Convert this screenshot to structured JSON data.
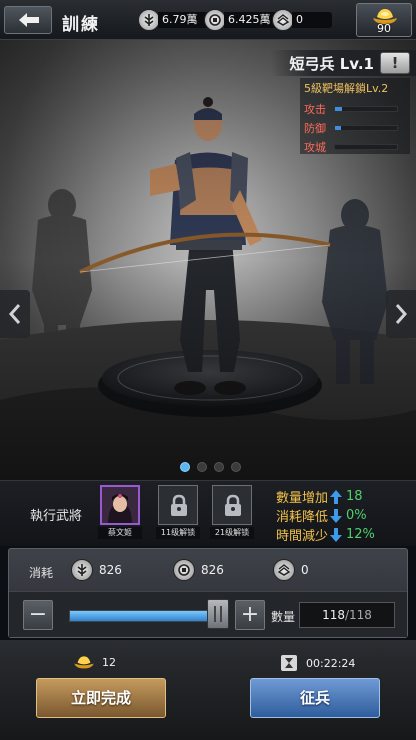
{
  "header": {
    "title": "訓練",
    "resources": [
      {
        "icon": "grain-icon",
        "value": "6.79萬"
      },
      {
        "icon": "coin-icon",
        "value": "6.425萬"
      },
      {
        "icon": "wood-icon",
        "value": "0"
      }
    ],
    "gold": {
      "icon": "gold-ingot-icon",
      "value": "90"
    }
  },
  "unit": {
    "name": "短弓兵 Lv.1",
    "unlock_text": "5級靶場解鎖Lv.2",
    "stats": [
      {
        "label": "攻击",
        "level": 0.12
      },
      {
        "label": "防御",
        "level": 0.1
      },
      {
        "label": "攻城",
        "level": 0.0
      }
    ],
    "page_count": 4,
    "active_page": 0
  },
  "general": {
    "label": "執行武將",
    "slots": [
      {
        "caption": "蔡文姬",
        "type": "hero"
      },
      {
        "caption": "11级解锁",
        "type": "locked"
      },
      {
        "caption": "21级解锁",
        "type": "locked"
      }
    ],
    "bonuses": [
      {
        "label": "數量增加",
        "dir": "up",
        "value": "18"
      },
      {
        "label": "消耗降低",
        "dir": "down",
        "value": "0%"
      },
      {
        "label": "時間減少",
        "dir": "down",
        "value": "12%"
      }
    ]
  },
  "cost": {
    "label": "消耗",
    "items": [
      {
        "icon": "grain-icon",
        "value": "826"
      },
      {
        "icon": "coin-icon",
        "value": "826"
      },
      {
        "icon": "wood-icon",
        "value": "0"
      }
    ]
  },
  "quantity": {
    "label": "數量",
    "current": "118",
    "max": "/118",
    "fraction": 1.0
  },
  "bottom": {
    "gold_cost": "12",
    "time": "00:22:24",
    "instant_label": "立即完成",
    "train_label": "征兵"
  }
}
